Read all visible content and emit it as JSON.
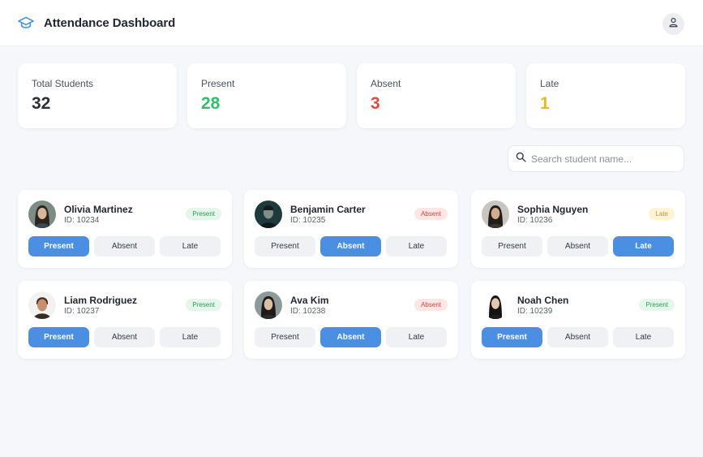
{
  "app": {
    "title": "Attendance Dashboard",
    "logo_icon": "graduation-cap-icon",
    "user_icon": "user-icon"
  },
  "colors": {
    "accent": "#4a8fe1",
    "present": "#2fbf6b",
    "absent": "#e0493f",
    "late": "#e9b824",
    "present_badge_bg": "#e4f7ea",
    "present_badge_fg": "#2e9e57",
    "absent_badge_bg": "#fde6e5",
    "absent_badge_fg": "#d2453c",
    "late_badge_bg": "#fdf4d6",
    "late_badge_fg": "#c4982a"
  },
  "stats": [
    {
      "label": "Total Students",
      "value": "32"
    },
    {
      "label": "Present",
      "value": "28"
    },
    {
      "label": "Absent",
      "value": "3"
    },
    {
      "label": "Late",
      "value": "1"
    }
  ],
  "search": {
    "placeholder": "Search student name...",
    "value": "",
    "icon": "search-icon"
  },
  "buttons": {
    "present": "Present",
    "absent": "Absent",
    "late": "Late"
  },
  "students": [
    {
      "name": "Olivia Martinez",
      "id": "ID: 10234",
      "status": "Present"
    },
    {
      "name": "Benjamin Carter",
      "id": "ID: 10235",
      "status": "Absent"
    },
    {
      "name": "Sophia Nguyen",
      "id": "ID: 10236",
      "status": "Late"
    },
    {
      "name": "Liam Rodriguez",
      "id": "ID: 10237",
      "status": "Present"
    },
    {
      "name": "Ava Kim",
      "id": "ID: 10238",
      "status": "Absent"
    },
    {
      "name": "Noah Chen",
      "id": "ID: 10239",
      "status": "Present"
    }
  ]
}
